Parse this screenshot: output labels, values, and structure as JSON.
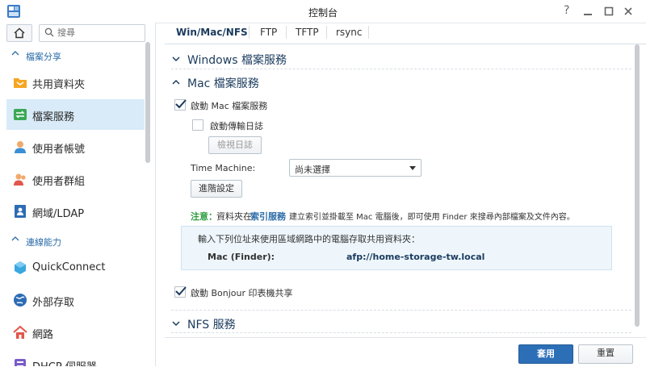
{
  "window": {
    "title": "控制台"
  },
  "sidebar": {
    "search_placeholder": "搜尋",
    "sections": [
      {
        "label": "檔案分享"
      },
      {
        "label": "連線能力"
      }
    ],
    "items": [
      {
        "label": "共用資料夾"
      },
      {
        "label": "檔案服務",
        "active": true
      },
      {
        "label": "使用者帳號"
      },
      {
        "label": "使用者群組"
      },
      {
        "label": "網域/LDAP"
      },
      {
        "label": "QuickConnect"
      },
      {
        "label": "外部存取"
      },
      {
        "label": "網路"
      },
      {
        "label": "DHCP 伺服器"
      }
    ]
  },
  "tabs": [
    {
      "label": "Win/Mac/NFS",
      "active": true
    },
    {
      "label": "FTP"
    },
    {
      "label": "TFTP"
    },
    {
      "label": "rsync"
    }
  ],
  "groups": {
    "windows": "Windows 檔案服務",
    "mac": "Mac 檔案服務",
    "nfs": "NFS 服務"
  },
  "mac": {
    "enable_mac": "啟動 Mac 檔案服務",
    "enable_mac_checked": true,
    "enable_log": "啟動傳輸日誌",
    "enable_log_checked": false,
    "view_log": "檢視日誌",
    "time_machine_label": "Time Machine:",
    "time_machine_value": "尚未選擇",
    "advanced": "進階設定",
    "note_label": "注意：",
    "note_pre": "資料夾在",
    "note_link": "索引服務",
    "note_post": "建立索引並掛載至 Mac 電腦後，即可使用 Finder 來搜尋內部檔案及文件內容。",
    "info_title": "輸入下列位址來使用區域網路中的電腦存取共用資料夾：",
    "finder_label": "Mac (Finder):",
    "finder_url": "afp://home-storage-tw.local",
    "bonjour": "啟動 Bonjour 印表機共享",
    "bonjour_checked": true
  },
  "footer": {
    "apply": "套用",
    "reset": "重置"
  },
  "colors": {
    "accent": "#2c6fb7",
    "active_bg": "#d9ebf8",
    "link": "#2c6ca8",
    "note": "#2e9c3f"
  }
}
